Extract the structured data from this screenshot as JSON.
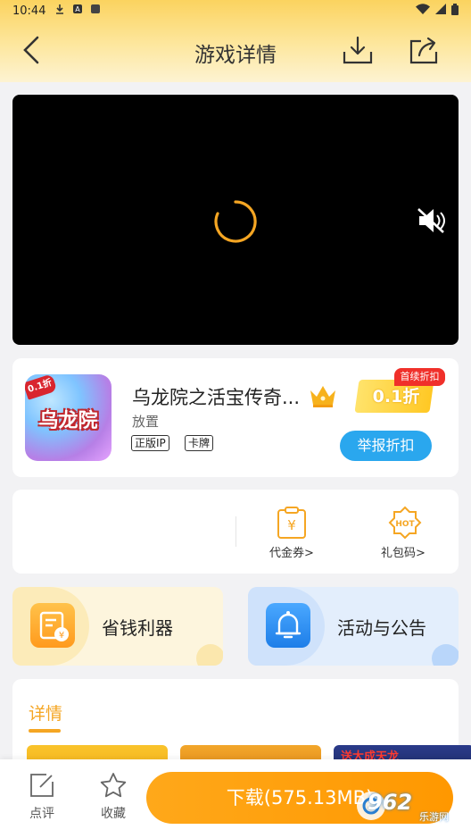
{
  "status_bar": {
    "time": "10:44"
  },
  "header": {
    "title": "游戏详情"
  },
  "game": {
    "name": "乌龙院之活宝传奇...",
    "category": "放置",
    "tags": [
      "正版IP",
      "卡牌"
    ],
    "discount": "0.1折",
    "first_discount_badge": "首续折扣",
    "report_button": "举报折扣",
    "icon_ribbon": "0.1折",
    "icon_logo": "乌龙院"
  },
  "benefits": [
    {
      "label": "代金券>",
      "icon": "voucher-icon"
    },
    {
      "label": "礼包码>",
      "icon": "hot-gift-icon"
    }
  ],
  "promos": [
    {
      "label": "省钱利器",
      "icon": "savings-icon"
    },
    {
      "label": "活动与公告",
      "icon": "bell-icon"
    }
  ],
  "details": {
    "title": "详情",
    "shot_text": "送大成天龙"
  },
  "bottom_bar": {
    "comment_label": "点评",
    "favorite_label": "收藏",
    "download_label": "下载(575.13MB)"
  },
  "watermark": {
    "number": "962",
    "site": ".NET",
    "sub": "乐游网"
  },
  "colors": {
    "accent": "#f5a623",
    "download": "#ff9800",
    "report": "#2aa7ee",
    "badge": "#f0302a"
  }
}
